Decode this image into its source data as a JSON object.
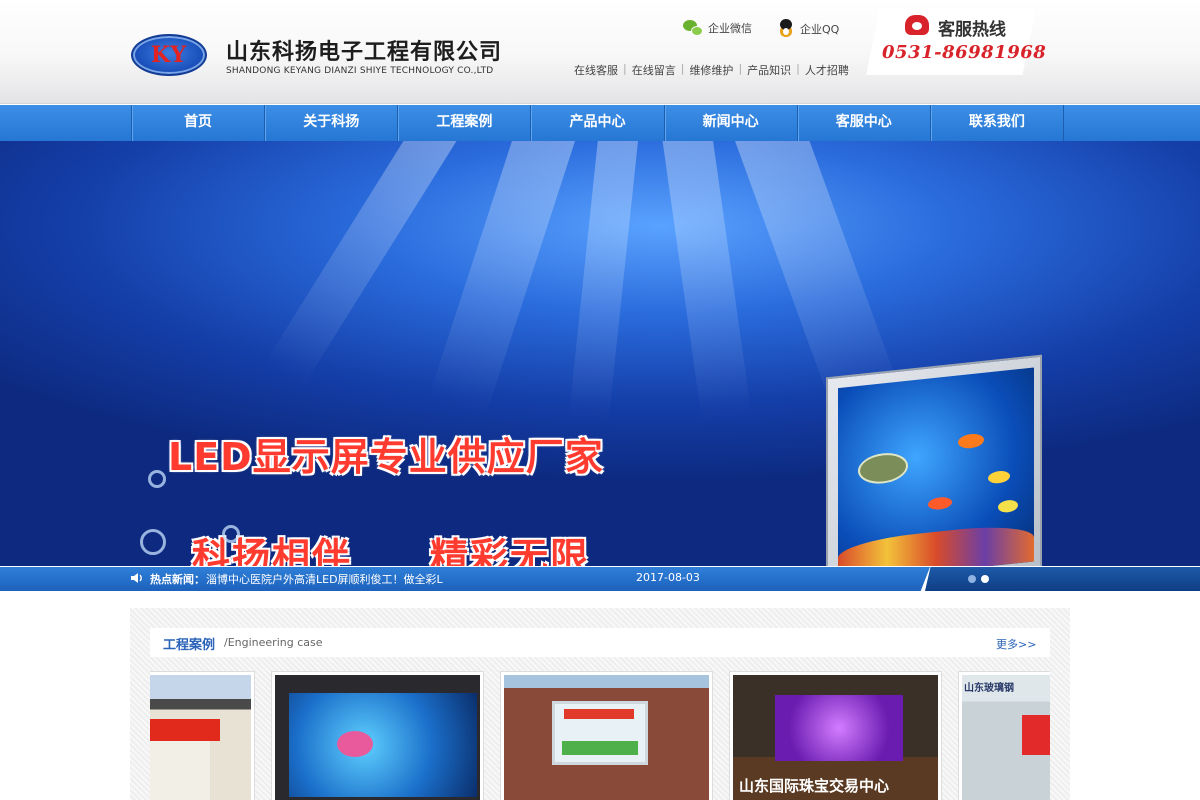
{
  "header": {
    "logo_text": "KY",
    "company_name": "山东科扬电子工程有限公司",
    "company_en": "SHANDONG KEYANG DIANZI SHIYE TECHNOLOGY CO.,LTD",
    "wechat_label": "企业微信",
    "qq_label": "企业QQ",
    "sub_links": [
      "在线客服",
      "在线留言",
      "维修维护",
      "产品知识",
      "人才招聘"
    ],
    "hotline_label": "客服热线",
    "hotline_number": "0531-86981968"
  },
  "nav": {
    "items": [
      "首页",
      "关于科扬",
      "工程案例",
      "产品中心",
      "新闻中心",
      "客服中心",
      "联系我们"
    ]
  },
  "banner": {
    "line1": "LED显示屏专业供应厂家",
    "line2": "科扬相伴",
    "line3": "精彩无限"
  },
  "news": {
    "label": "热点新闻：",
    "text": "淄博中心医院户外高清LED屏顺利俊工！做全彩L",
    "date": "2017-08-03",
    "active_slide": 2,
    "slide_count": 2
  },
  "cases": {
    "title": "工程案例",
    "subtitle": "/Engineering case",
    "more": "更多>>",
    "captions": [
      "山东国际珠宝交易中心",
      "山东玻璃钢"
    ]
  },
  "colors": {
    "nav_blue": "#2677d4",
    "accent_red": "#d8232a",
    "link_blue": "#2a63b8"
  }
}
